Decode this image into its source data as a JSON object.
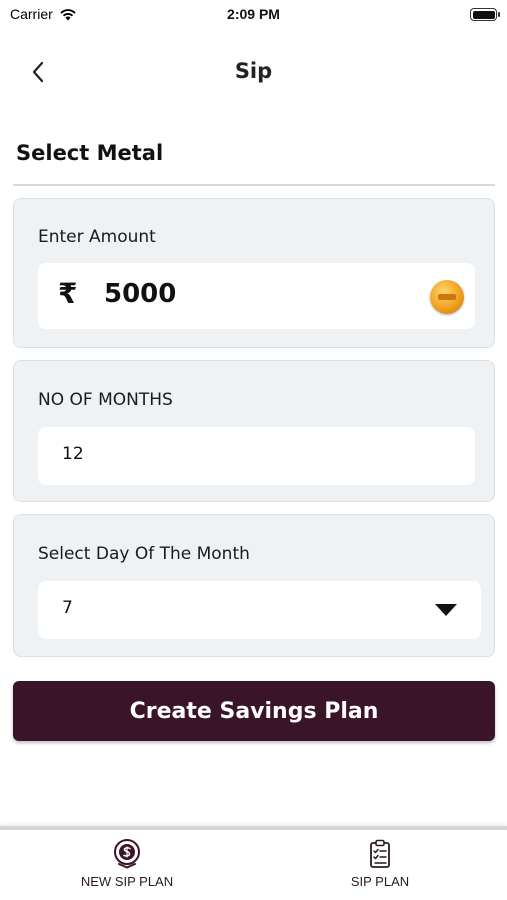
{
  "status_bar": {
    "carrier": "Carrier",
    "time": "2:09 PM"
  },
  "header": {
    "title": "Sip",
    "back_icon": "chevron-left-icon"
  },
  "section": {
    "title": "Select Metal"
  },
  "amount": {
    "label": "Enter Amount",
    "currency_symbol": "₹",
    "value": "5000",
    "coin_icon": "gold-coin-icon"
  },
  "months": {
    "label": "NO OF MONTHS",
    "value": "12"
  },
  "day": {
    "label": "Select Day Of The Month",
    "value": "7",
    "dropdown_icon": "caret-down-icon"
  },
  "create_button": {
    "label": "Create Savings Plan"
  },
  "tabs": [
    {
      "label": "NEW SIP PLAN",
      "icon": "dollar-circle-icon",
      "active": true
    },
    {
      "label": "SIP PLAN",
      "icon": "clipboard-list-icon",
      "active": false
    }
  ],
  "colors": {
    "primary": "#3a1428",
    "card_background": "#eff2f5",
    "coin_gold": "#f0a020"
  }
}
